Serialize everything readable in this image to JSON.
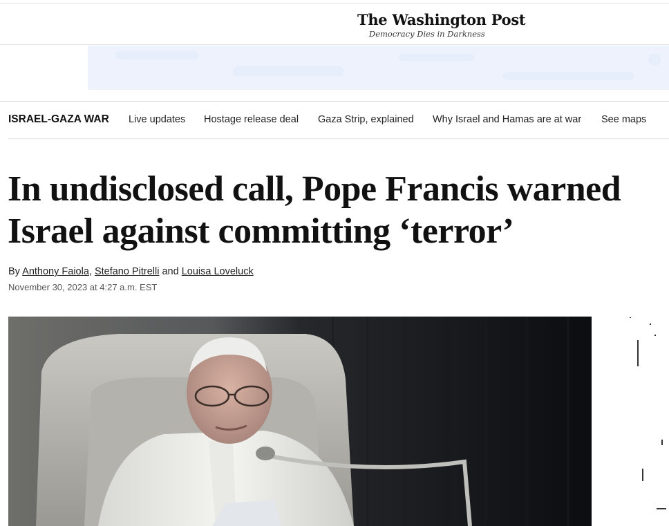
{
  "masthead": {
    "logo": "The Washington Post",
    "tagline": "Democracy Dies in Darkness"
  },
  "subnav": {
    "title": "ISRAEL-GAZA WAR",
    "links": [
      "Live updates",
      "Hostage release deal",
      "Gaza Strip, explained",
      "Why Israel and Hamas are at war",
      "See maps"
    ]
  },
  "article": {
    "headline": "In undisclosed call, Pope Francis warned Israel against committing ‘terror’",
    "byline": {
      "prefix": "By ",
      "authors": [
        "Anthony Faiola",
        "Stefano Pitrelli",
        "Louisa Loveluck"
      ],
      "sep1": ", ",
      "sep2": " and "
    },
    "date": "November 30, 2023 at 4:27 a.m. EST"
  },
  "colors": {
    "ad_background": "#edf2fd",
    "text": "#111111",
    "divider": "#e4e4e4"
  }
}
